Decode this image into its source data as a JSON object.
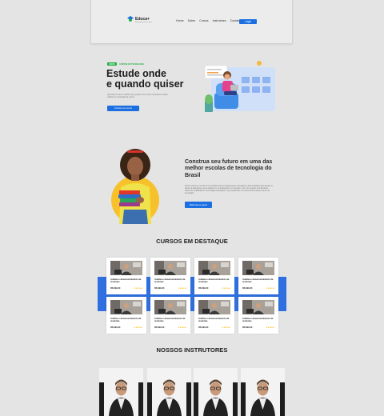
{
  "header": {
    "brand": "Educa+",
    "brand_sub": "Educação para o futuro",
    "nav": [
      "Home",
      "Sobre",
      "Cursos",
      "Instrutores",
      "Contato"
    ],
    "login_label": "Login",
    "colors": {
      "accent": "#1b6fe0",
      "green": "#1fad3e"
    }
  },
  "hero": {
    "badge": "NOVO",
    "badge_text": "CURSOS DE TECNOLOGIA",
    "title_line1": "Estude onde",
    "title_line2": "e quando quiser",
    "description": "Aprenda no ritmo e horários que preferir com cursos completos, acesso vitalício de tecnologia do ensino",
    "button_label": "Conheça os cursos"
  },
  "about": {
    "title": "Construa seu futuro em uma das melhor escolas de tecnologia do Brasil",
    "description": "Nossa escola de cursos de tecnologia oferece programas de formação de alta qualidade para ajudar os alunos a alcançarem seus objetivos e se destacarem no mercado. Com uma equipe de instrutores altamente qualificados e tecnologias avançadas, nós preparamos os nossos alunos para o futuro da tecnologia.",
    "button_label": "Matricule-se agora!"
  },
  "courses": {
    "section_title": "CURSOS EM DESTAQUE",
    "items": [
      {
        "name": "Análise e desenvolvimento de sistemas",
        "price": "R$ 299,00",
        "stars": "★★★★★"
      },
      {
        "name": "Análise e desenvolvimento de sistemas",
        "price": "R$ 299,00",
        "stars": "★★★★★"
      },
      {
        "name": "Análise e desenvolvimento de sistemas",
        "price": "R$ 299,00",
        "stars": "★★★★★"
      },
      {
        "name": "Análise e desenvolvimento de sistemas",
        "price": "R$ 299,00",
        "stars": "★★★★★"
      },
      {
        "name": "Análise e desenvolvimento de sistemas",
        "price": "R$ 299,00",
        "stars": "★★★★★"
      },
      {
        "name": "Análise e desenvolvimento de sistemas",
        "price": "R$ 299,00",
        "stars": "★★★★★"
      },
      {
        "name": "Análise e desenvolvimento de sistemas",
        "price": "R$ 299,00",
        "stars": "★★★★★"
      },
      {
        "name": "Análise e desenvolvimento de sistemas",
        "price": "R$ 299,00",
        "stars": "★★★★★"
      }
    ]
  },
  "instructors": {
    "section_title": "NOSSOS INSTRUTORES",
    "count": 4
  }
}
